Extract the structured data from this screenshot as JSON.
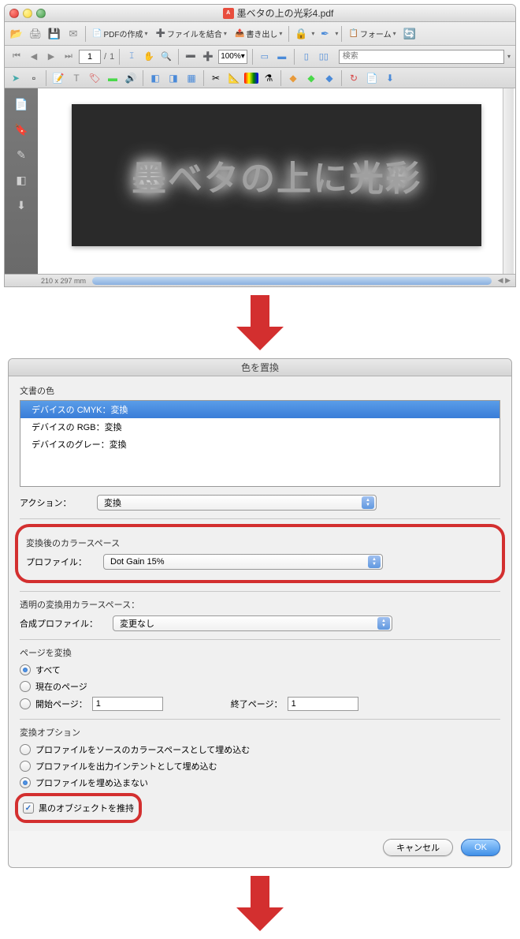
{
  "window1": {
    "title": "墨ベタの上の光彩4.pdf",
    "toolbar": {
      "pdf_create": "PDFの作成",
      "file_merge": "ファイルを結合",
      "export": "書き出し",
      "secure": "",
      "sign": "",
      "form": "フォーム"
    },
    "nav": {
      "page_current": "1",
      "page_total": "1",
      "zoom": "100%",
      "search_placeholder": "検索"
    },
    "document": {
      "text": "墨ベタの上に光彩",
      "dimensions": "210 x 297 mm"
    }
  },
  "dialog": {
    "title": "色を置換",
    "doc_colors_label": "文書の色",
    "list": [
      "デバイスの CMYK：変換",
      "デバイスの RGB：変換",
      "デバイスのグレー：変換"
    ],
    "action_label": "アクション：",
    "action_value": "変換",
    "target_space_title": "変換後のカラースペース",
    "profile_label": "プロファイル：",
    "profile_value": "Dot Gain 15%",
    "transparency_title": "透明の変換用カラースペース：",
    "blend_profile_label": "合成プロファイル：",
    "blend_profile_value": "変更なし",
    "pages_title": "ページを変換",
    "radio_all": "すべて",
    "radio_current": "現在のページ",
    "radio_range": "開始ページ：",
    "range_start": "1",
    "range_end_label": "終了ページ：",
    "range_end": "1",
    "options_title": "変換オプション",
    "opt_embed_source": "プロファイルをソースのカラースペースとして埋め込む",
    "opt_embed_output": "プロファイルを出力インテントとして埋め込む",
    "opt_no_embed": "プロファイルを埋め込まない",
    "opt_preserve_black": "黒のオブジェクトを推持",
    "cancel": "キャンセル",
    "ok": "OK"
  }
}
